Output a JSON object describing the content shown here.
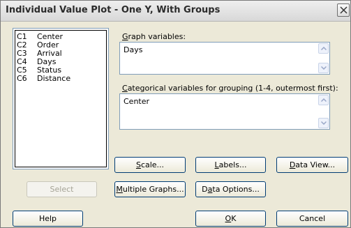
{
  "window": {
    "title": "Individual Value Plot - One Y, With Groups"
  },
  "variables": [
    {
      "col": "C1",
      "name": "Center"
    },
    {
      "col": "C2",
      "name": "Order"
    },
    {
      "col": "C3",
      "name": "Arrival"
    },
    {
      "col": "C4",
      "name": "Days"
    },
    {
      "col": "C5",
      "name": "Status"
    },
    {
      "col": "C6",
      "name": "Distance"
    }
  ],
  "graph_variables": {
    "label_first": "G",
    "label_rest": "raph variables:",
    "value": "Days"
  },
  "categorical": {
    "label_first": "C",
    "label_rest": "ategorical variables for grouping (1-4, outermost first):",
    "value": "Center"
  },
  "buttons": {
    "scale": {
      "first": "S",
      "rest": "cale..."
    },
    "labels": {
      "first": "L",
      "rest": "abels..."
    },
    "data_view": {
      "first": "D",
      "rest": "ata View..."
    },
    "select": "Select",
    "multiple_graphs": {
      "first": "M",
      "rest": "ultiple Graphs..."
    },
    "data_options": {
      "before": "D",
      "first": "a",
      "rest": "ta Options..."
    },
    "help": "Help",
    "ok": {
      "first": "O",
      "rest": "K"
    },
    "cancel": "Cancel"
  }
}
